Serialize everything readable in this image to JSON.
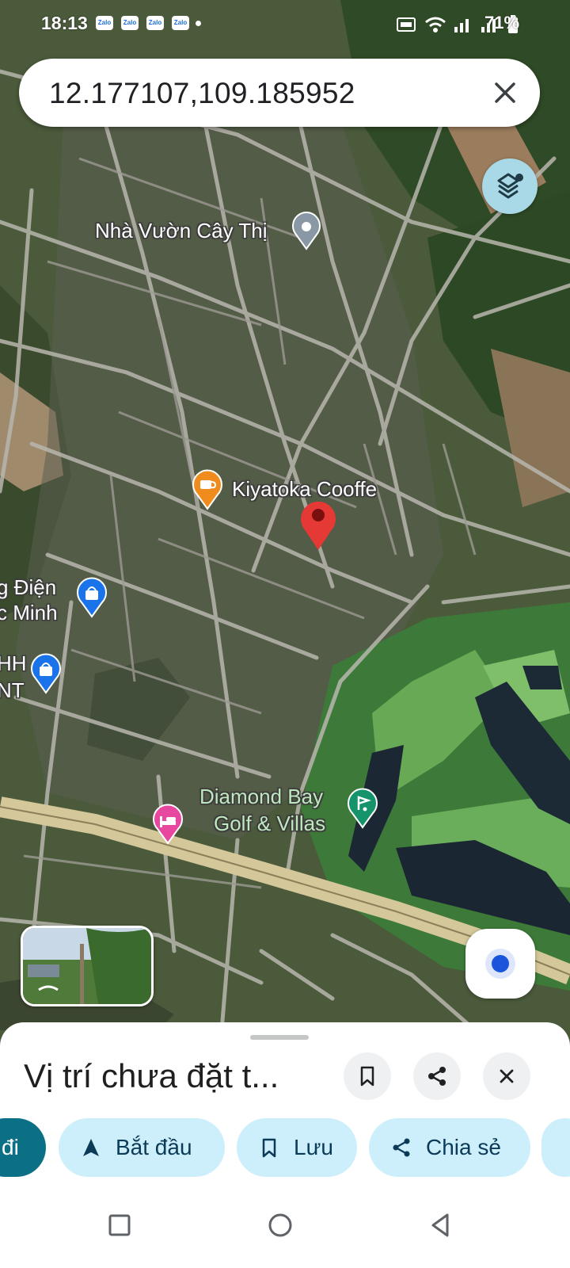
{
  "status_bar": {
    "time": "18:13",
    "notification_icons": [
      "Zalo",
      "Zalo",
      "Zalo",
      "Zalo"
    ],
    "battery": "71%"
  },
  "search": {
    "query": "12.177107,109.185952"
  },
  "map": {
    "labels": {
      "garden": "Nhà Vườn Cây Thị",
      "cafe": "Kiyatoka Cooffe",
      "store1_line1": "g Điện",
      "store1_line2": "c Minh",
      "store2_line1": "HH",
      "store2_line2": "NT",
      "golf_line1": "Diamond Bay",
      "golf_line2": "Golf & Villas"
    },
    "colors": {
      "pin": "#e53935",
      "cafe": "#f08c1e",
      "store": "#1a73e8",
      "hotel": "#e8479f",
      "golf": "#15946b"
    }
  },
  "bottom_sheet": {
    "title": "Vị trí chưa đặt t...",
    "chips": {
      "directions": "đi",
      "start": "Bắt đầu",
      "save": "Lưu",
      "share": "Chia sẻ"
    }
  }
}
